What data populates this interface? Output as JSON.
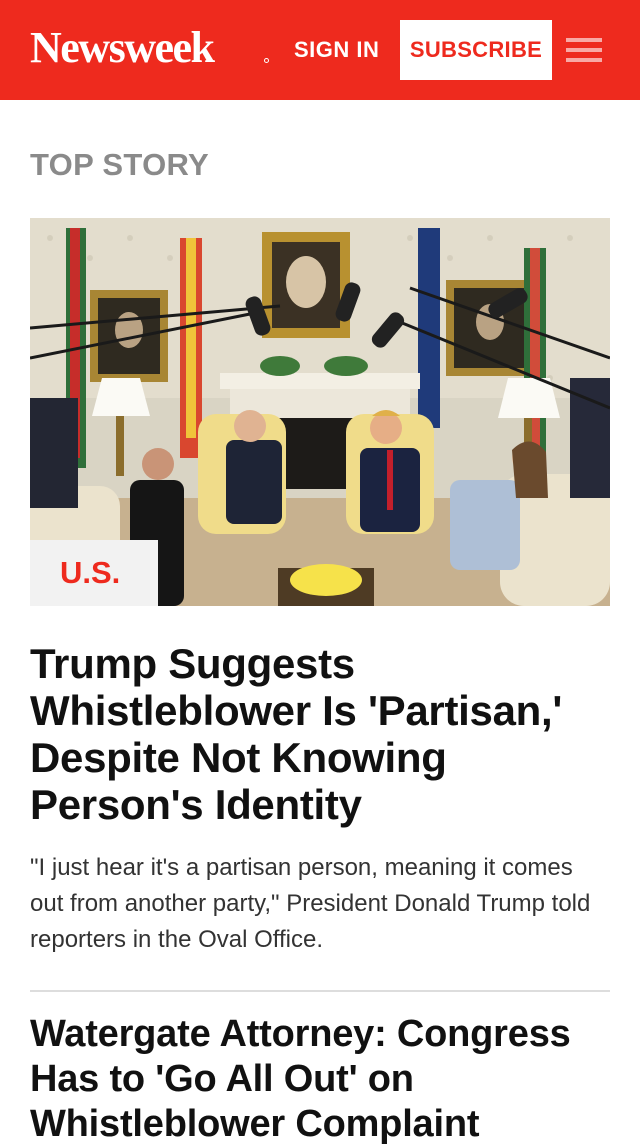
{
  "header": {
    "logo": "Newsweek",
    "sign_in_label": "SIGN IN",
    "subscribe_label": "SUBSCRIBE",
    "menu_icon": "hamburger-menu-icon",
    "brand_color": "#ee2a1e"
  },
  "top_story": {
    "section_label": "TOP STORY",
    "category": "U.S.",
    "headline": "Trump Suggests Whistleblower Is 'Partisan,' Despite Not Knowing Person's Identity",
    "summary": "\"I just hear it's a partisan person, meaning it comes out from another party,\" President Donald Trump told reporters in the Oval Office."
  },
  "next_story": {
    "headline": "Watergate Attorney: Congress Has to 'Go All Out' on Whistleblower Complaint"
  },
  "colors": {
    "accent": "#ee2a1e",
    "section_label": "#8a8a8a",
    "headline": "#111111",
    "body_text": "#333333",
    "divider": "#dddddd"
  }
}
